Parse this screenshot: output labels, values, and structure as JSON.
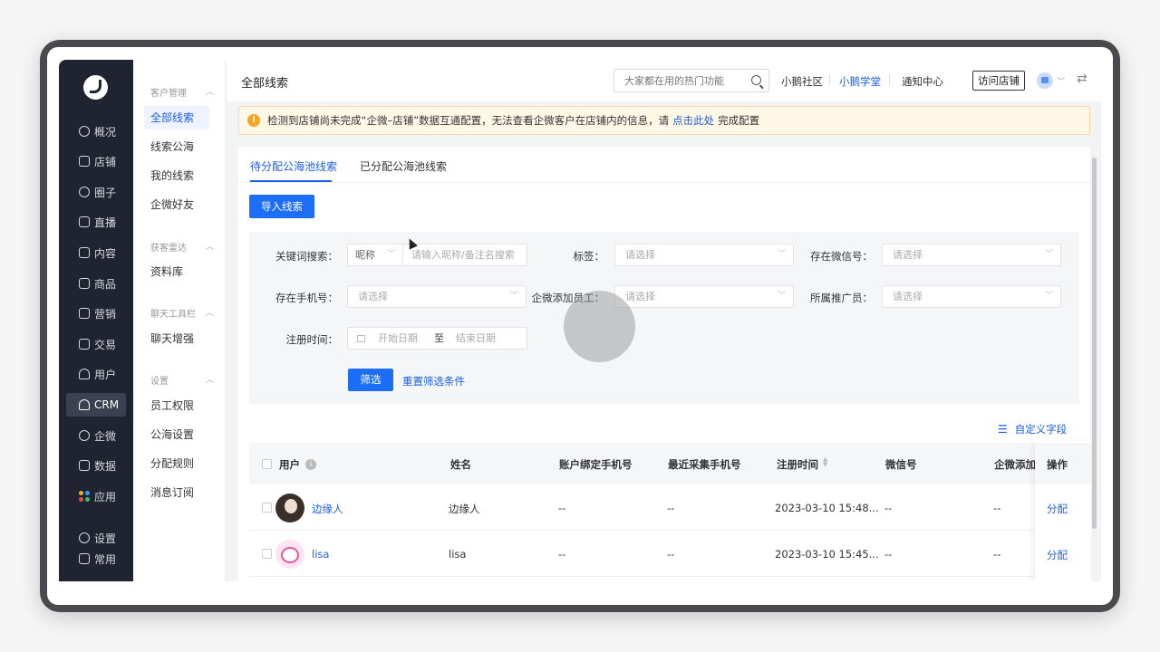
{
  "nav": {
    "items": [
      {
        "label": "概况",
        "icon": "pie-chart-icon"
      },
      {
        "label": "店铺",
        "icon": "store-icon"
      },
      {
        "label": "圈子",
        "icon": "people-icon"
      },
      {
        "label": "直播",
        "icon": "live-icon"
      },
      {
        "label": "内容",
        "icon": "document-icon"
      },
      {
        "label": "商品",
        "icon": "goods-icon"
      },
      {
        "label": "营销",
        "icon": "megaphone-icon"
      },
      {
        "label": "交易",
        "icon": "trade-icon"
      },
      {
        "label": "用户",
        "icon": "user-icon"
      },
      {
        "label": "CRM",
        "icon": "crm-icon"
      },
      {
        "label": "企微",
        "icon": "wecom-icon"
      },
      {
        "label": "数据",
        "icon": "data-icon"
      },
      {
        "label": "应用",
        "icon": "apps-icon"
      },
      {
        "label": "设置",
        "icon": "gear-icon"
      },
      {
        "label": "常用",
        "icon": "list-icon"
      }
    ]
  },
  "subnav": {
    "groups": [
      {
        "title": "客户管理",
        "items": [
          "全部线索",
          "线索公海",
          "我的线索",
          "企微好友"
        ]
      },
      {
        "title": "获客雷达",
        "items": [
          "资料库"
        ]
      },
      {
        "title": "聊天工具栏",
        "items": [
          "聊天增强"
        ]
      },
      {
        "title": "设置",
        "items": [
          "员工权限",
          "公海设置",
          "分配规则",
          "消息订阅"
        ]
      }
    ]
  },
  "header": {
    "title": "全部线索",
    "search_placeholder": "大家都在用的热门功能",
    "links": [
      "小鹅社区",
      "小鹅学堂",
      "通知中心"
    ],
    "visit_store": "访问店铺"
  },
  "alert": {
    "text_before": "检测到店铺尚未完成“企微–店铺”数据互通配置，无法查看企微客户在店铺内的信息，请",
    "link": "点击此处",
    "text_after": "完成配置"
  },
  "tabs": [
    "待分配公海池线索",
    "已分配公海池线索"
  ],
  "import_button": "导入线索",
  "filters": {
    "keyword_label": "关键词搜索：",
    "keyword_type": "昵称",
    "keyword_placeholder": "请输入昵称/备注名搜索",
    "tag_label": "标签：",
    "wechat_label": "存在微信号：",
    "phone_label": "存在手机号：",
    "staff_label": "企微添加员工：",
    "promoter_label": "所属推广员：",
    "select_placeholder": "请选择",
    "reg_label": "注册时间：",
    "start_date": "开始日期",
    "to": "至",
    "end_date": "结束日期",
    "submit": "筛选",
    "reset": "重置筛选条件"
  },
  "custom_fields": "自定义字段",
  "table": {
    "columns": [
      "用户",
      "姓名",
      "账户绑定手机号",
      "最近采集手机号",
      "注册时间",
      "微信号",
      "企微添加",
      "操作"
    ],
    "rows": [
      {
        "user": "边缘人",
        "name": "边缘人",
        "bound_phone": "--",
        "recent_phone": "--",
        "reg_time": "2023-03-10 15:48...",
        "wechat": "--",
        "wecom": "--",
        "action": "分配"
      },
      {
        "user": "lisa",
        "name": "lisa",
        "bound_phone": "--",
        "recent_phone": "--",
        "reg_time": "2023-03-10 15:45...",
        "wechat": "--",
        "wecom": "--",
        "action": "分配"
      }
    ]
  }
}
